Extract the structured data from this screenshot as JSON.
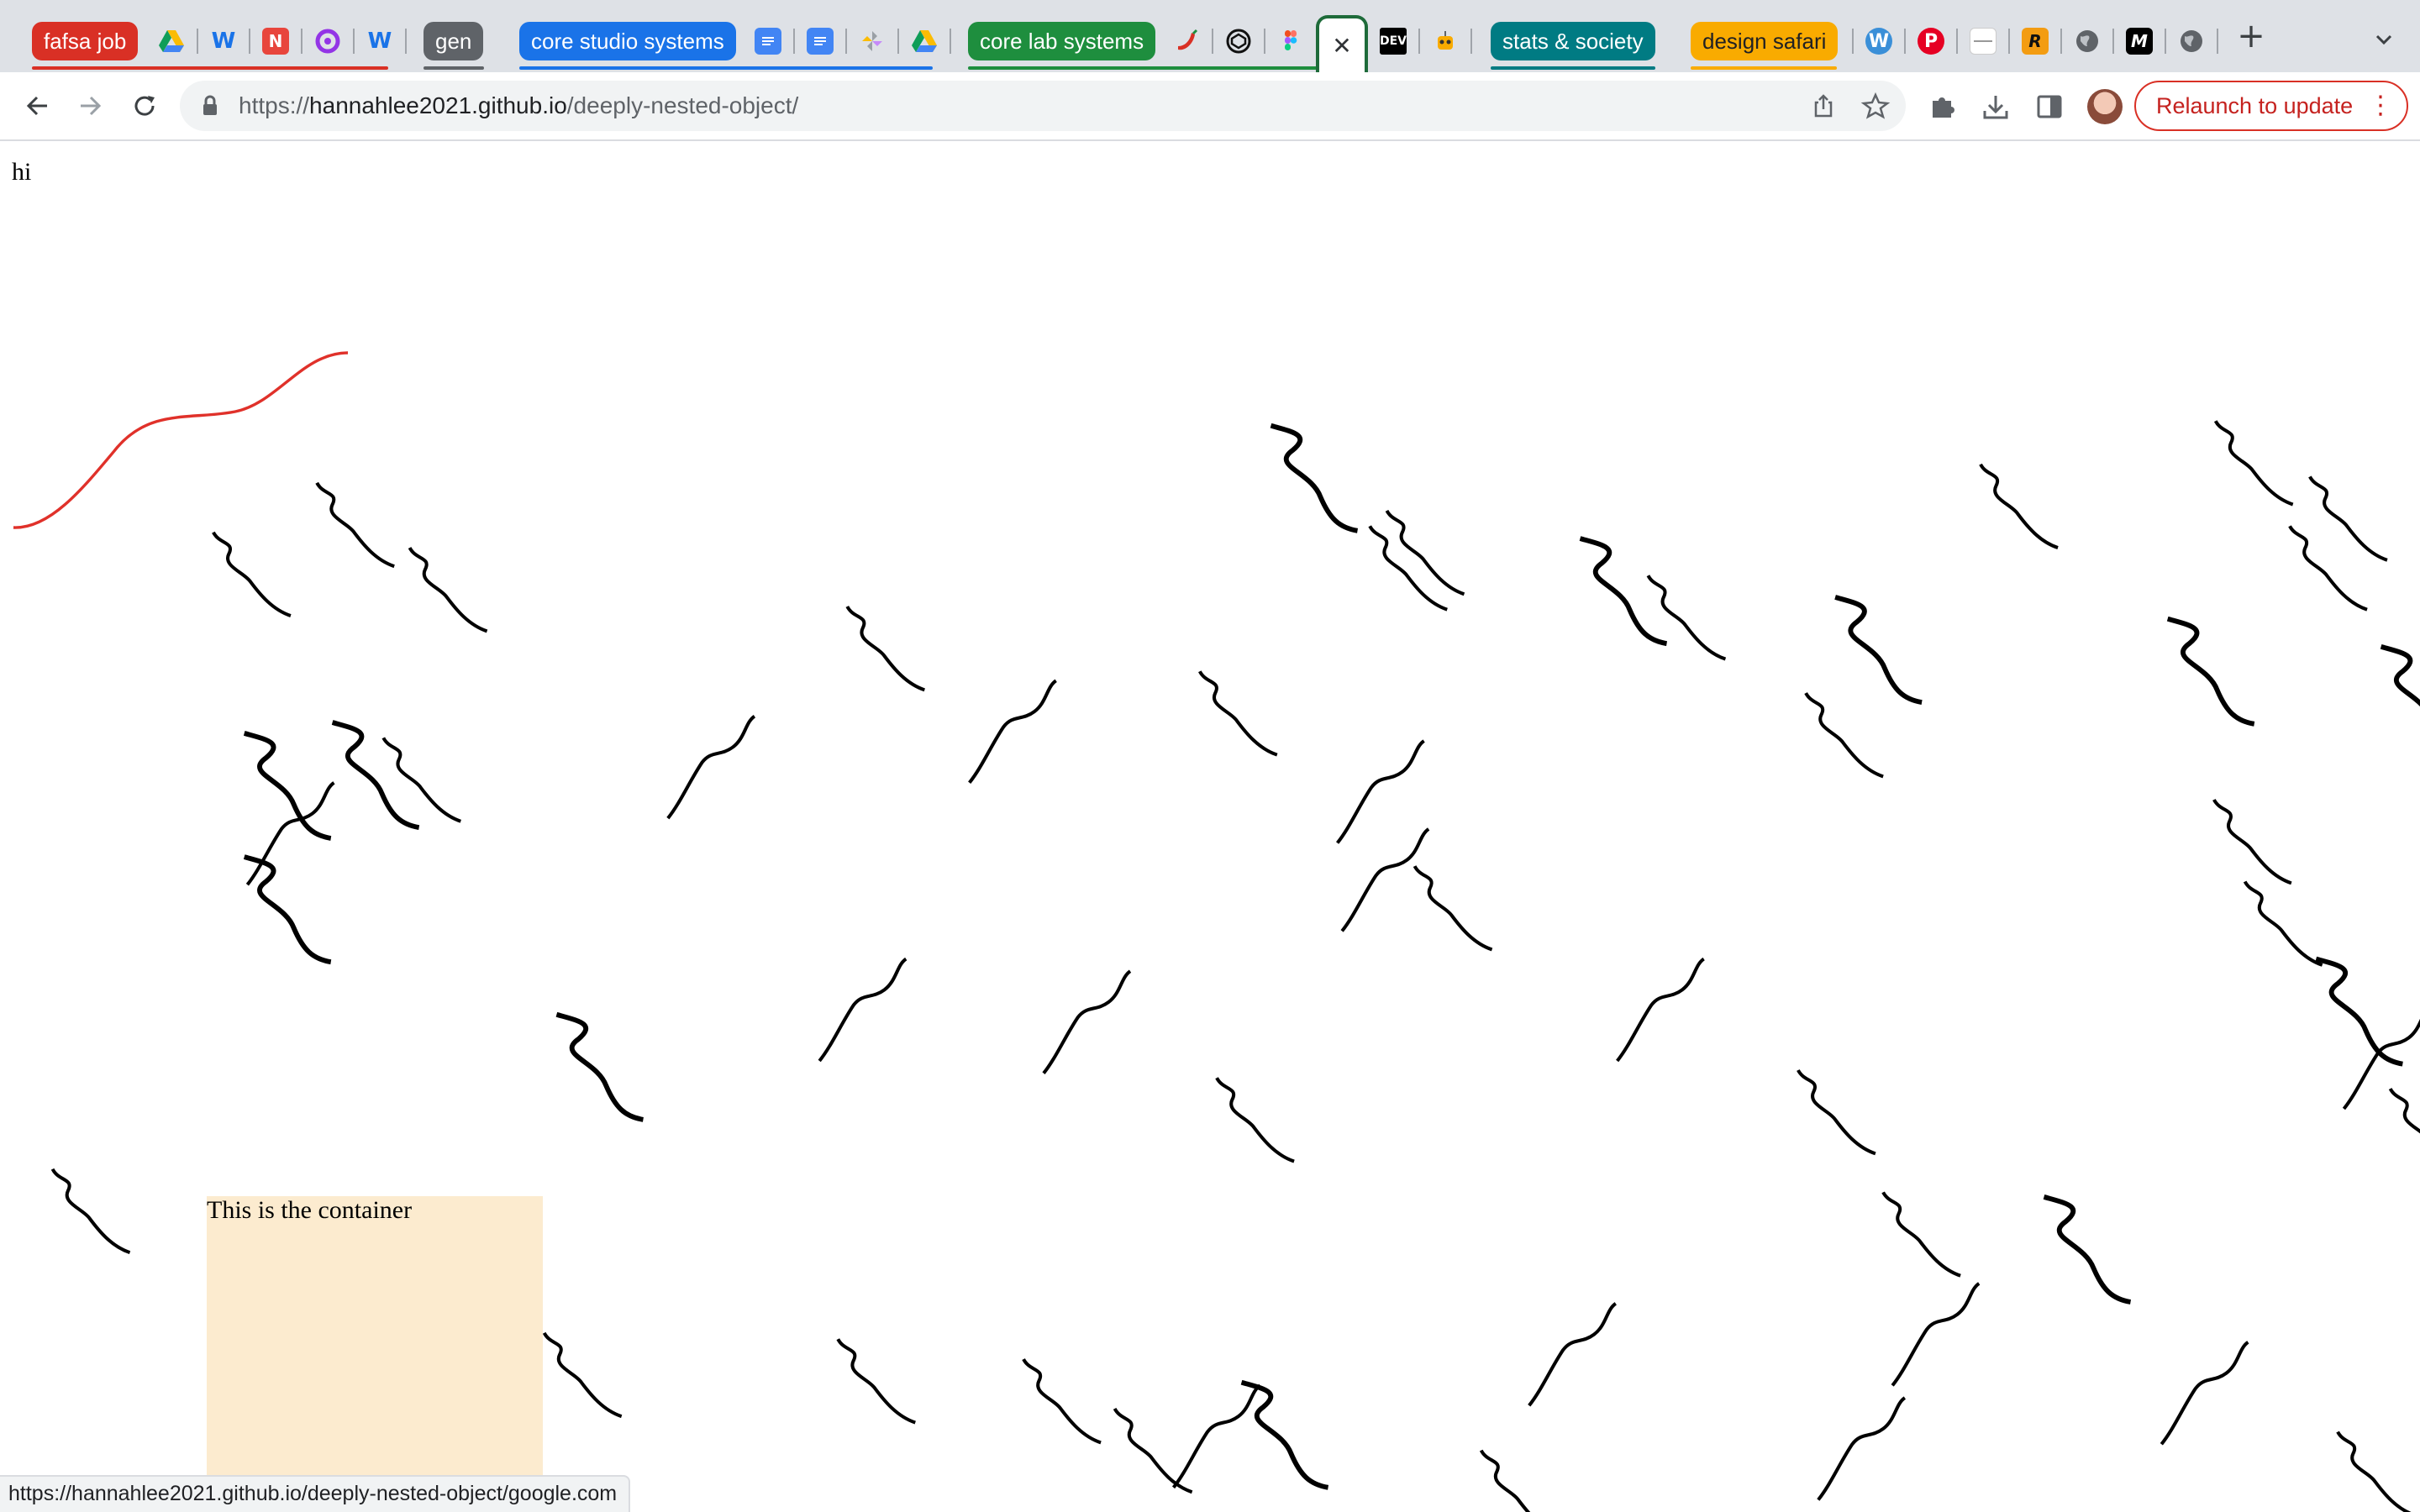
{
  "browser": {
    "tab_groups": [
      {
        "label": "fafsa job",
        "color": "#d93025",
        "text_color": "#ffffff"
      },
      {
        "label": "gen",
        "color": "#5f6368",
        "text_color": "#ffffff"
      },
      {
        "label": "core studio systems",
        "color": "#1a73e8",
        "text_color": "#ffffff"
      },
      {
        "label": "core lab systems",
        "color": "#1e8e3e",
        "text_color": "#ffffff"
      },
      {
        "label": "stats & society",
        "color": "#007b83",
        "text_color": "#ffffff"
      },
      {
        "label": "design safari",
        "color": "#f9ab00",
        "text_color": "#202124"
      }
    ],
    "tab_icons": [
      "google-drive-icon",
      "wordtune-icon",
      "notion-n-icon",
      "purple-ring-icon",
      "wordtune-icon",
      "google-docs-icon",
      "google-docs-icon",
      "pinwheel-icon",
      "google-drive-icon",
      "chili-pepper-icon",
      "codepen-icon",
      "figma-icon",
      "dev-icon",
      "robot-icon",
      "wordpress-icon",
      "pinterest-icon",
      "dashes-icon",
      "r-logo-icon",
      "globe-icon",
      "medium-icon",
      "globe-icon"
    ],
    "dev_favicon_text": "DEV",
    "r_favicon_text": "R",
    "medium_favicon_text": "M",
    "wordtune_text": "W",
    "notion_text": "N",
    "wordpress_text": "W",
    "pinterest_text": "P",
    "close_glyph": "✕",
    "new_tab_glyph": "+",
    "url": {
      "scheme": "https://",
      "host": "hannahlee2021.github.io",
      "path": "/deeply-nested-object/"
    },
    "relaunch_label": "Relaunch to update",
    "kebab_glyph": "⋮"
  },
  "page": {
    "heading_text": "hi",
    "container_text": "This is the container",
    "status_url": "https://hannahlee2021.github.io/deeply-nested-object/google.com",
    "curve_color": "#e0312a"
  }
}
